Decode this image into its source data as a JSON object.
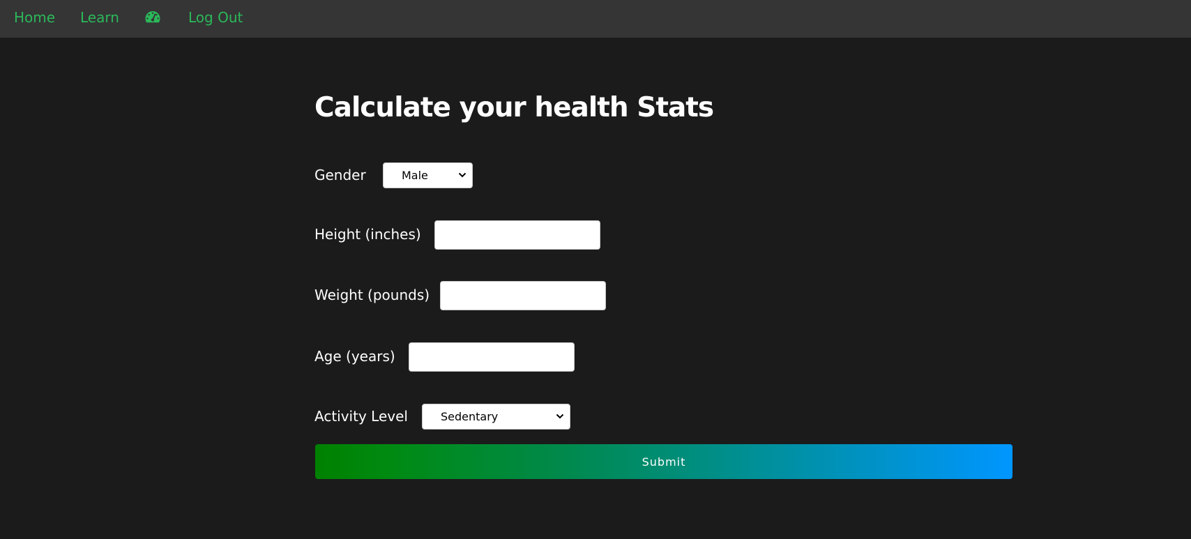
{
  "nav": {
    "home_label": "Home",
    "learn_label": "Learn",
    "dashboard_icon": "speedometer-icon",
    "logout_label": "Log Out",
    "link_color": "#2bb85a"
  },
  "form": {
    "title": "Calculate your health Stats",
    "gender_label": "Gender",
    "gender_value": "Male",
    "height_label": "Height (inches)",
    "height_value": "",
    "weight_label": "Weight (pounds)",
    "weight_value": "",
    "age_label": "Age (years)",
    "age_value": "",
    "activity_label": "Activity Level",
    "activity_value": "Sedentary",
    "submit_label": "Submit"
  },
  "colors": {
    "background": "#1b1b1b",
    "navbar": "#353535",
    "gradient_start": "#008000",
    "gradient_end": "#0096ff"
  }
}
